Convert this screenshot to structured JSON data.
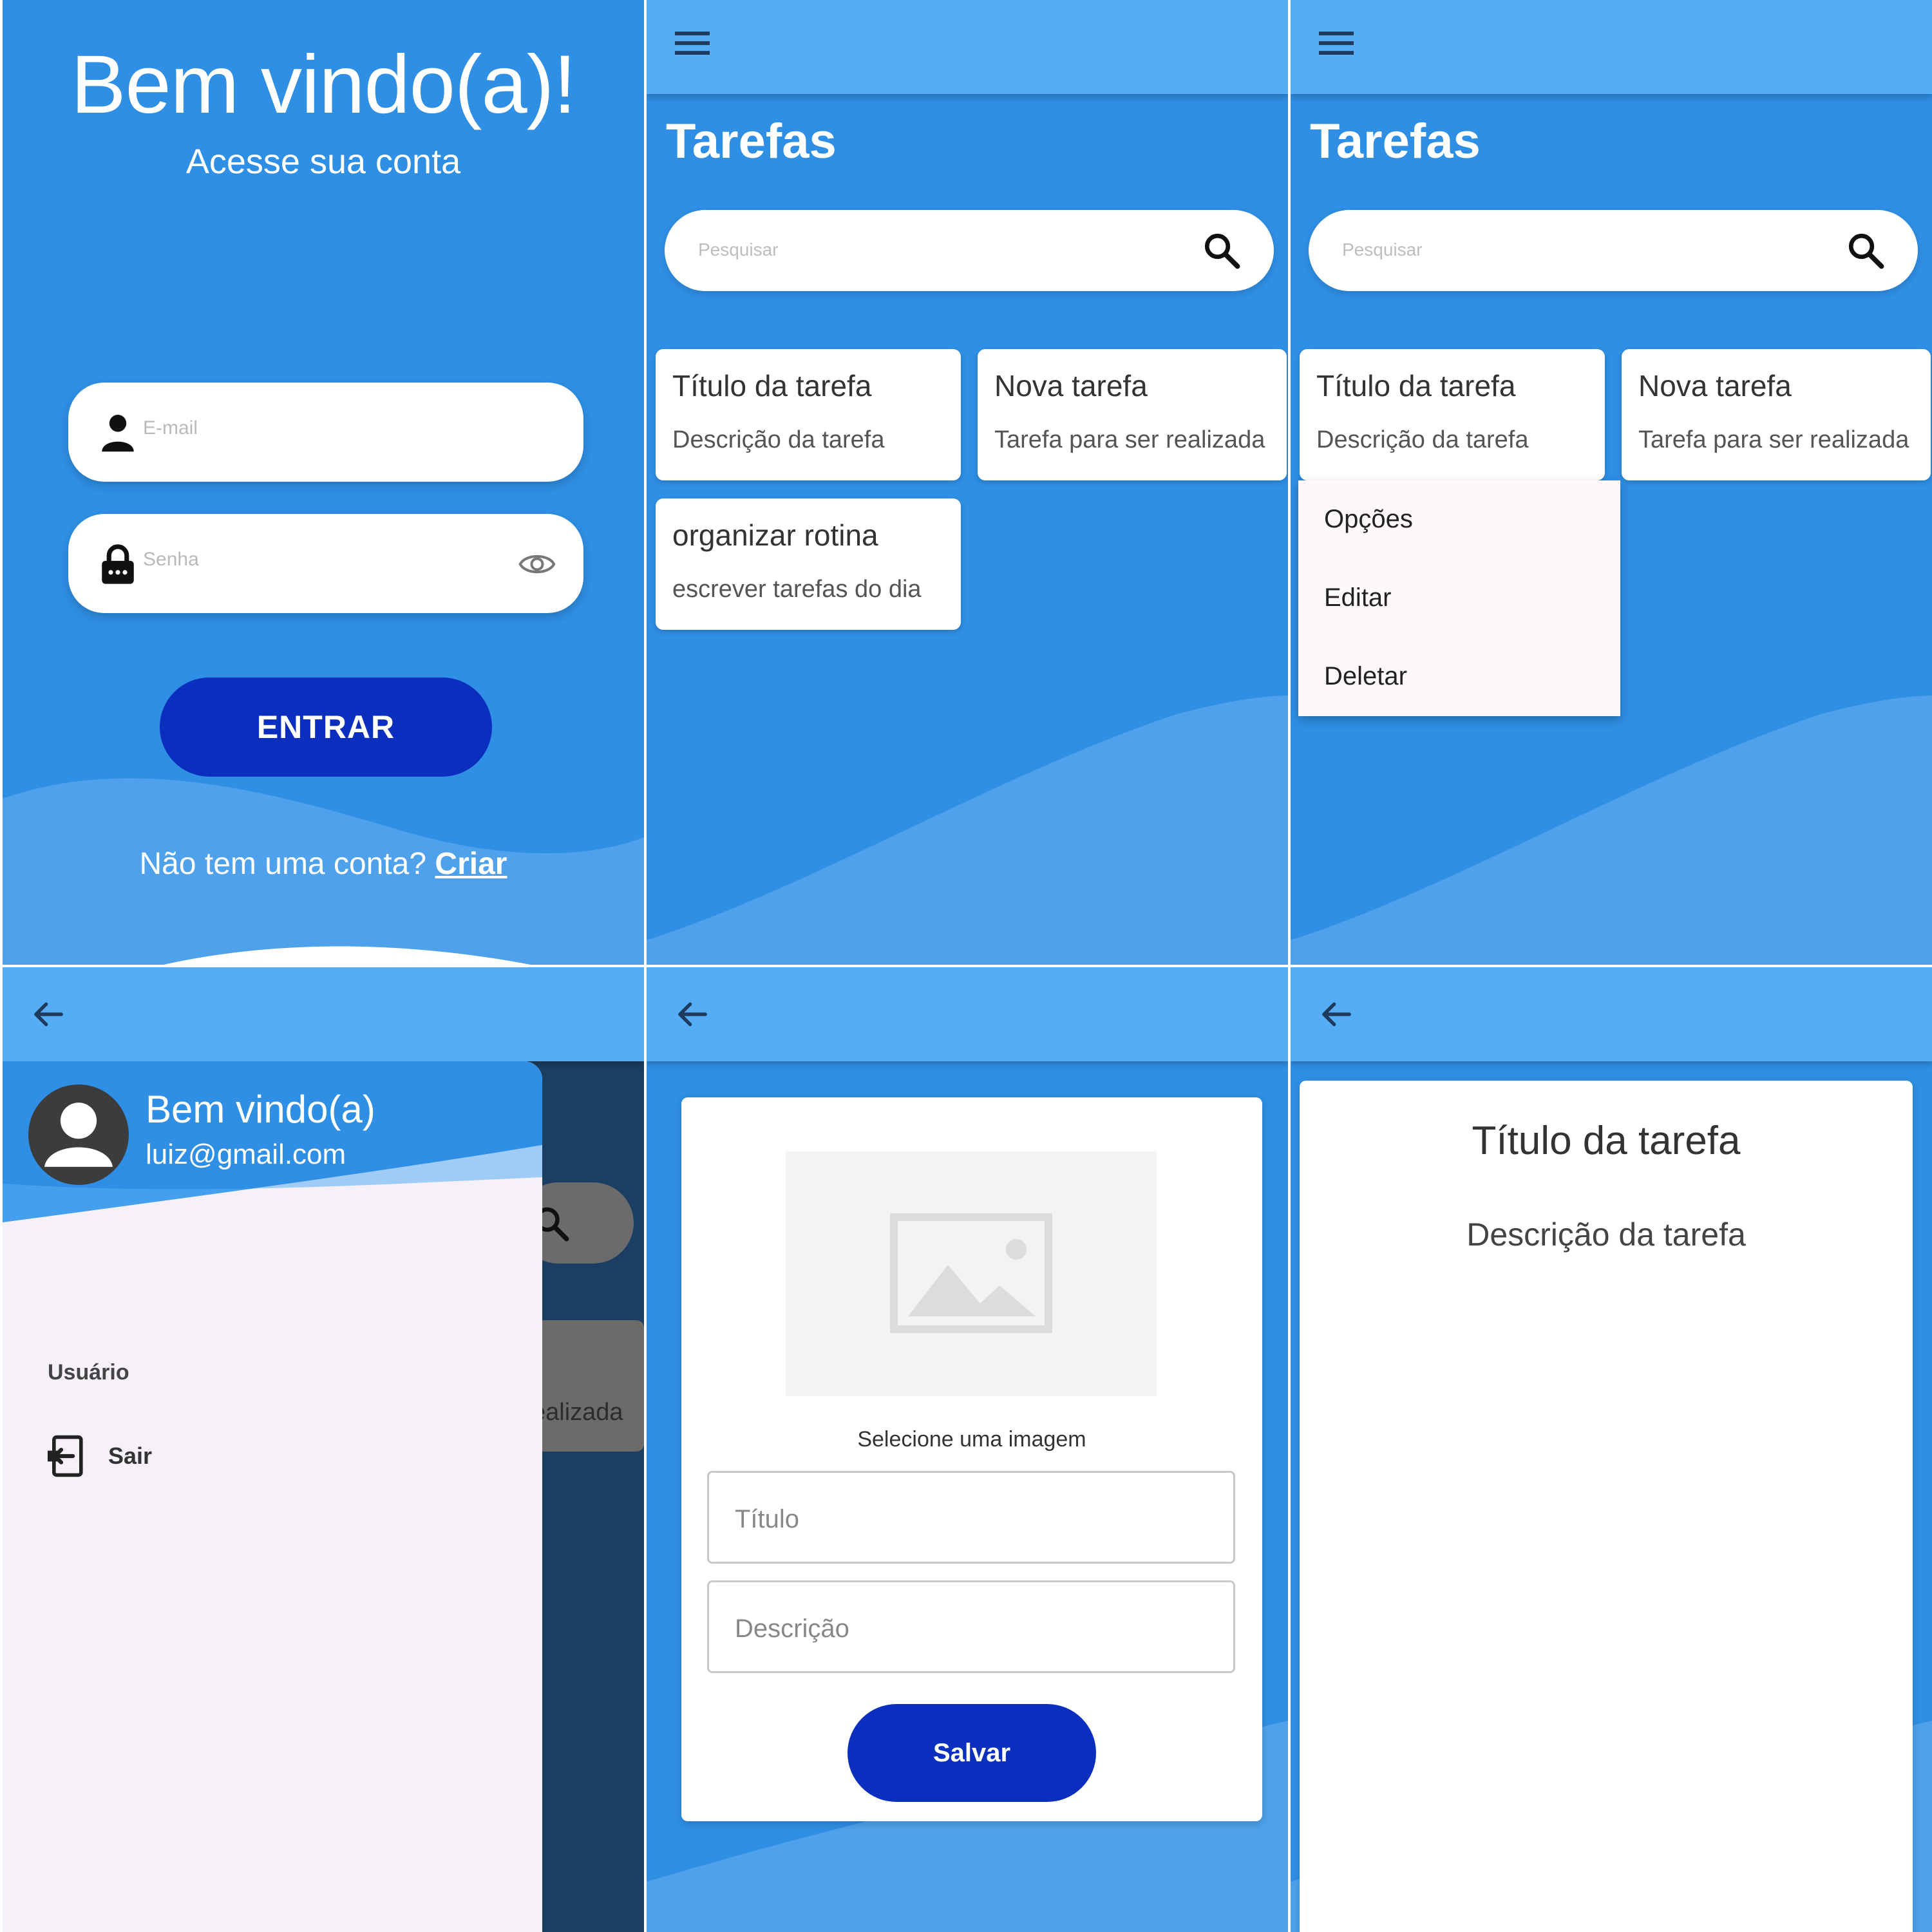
{
  "login": {
    "title": "Bem vindo(a)!",
    "subtitle": "Acesse sua conta",
    "email_placeholder": "E-mail",
    "password_placeholder": "Senha",
    "submit_label": "ENTRAR",
    "signup_prompt": "Não tem uma conta?",
    "signup_link": "Criar"
  },
  "tasks": {
    "title": "Tarefas",
    "search_placeholder": "Pesquisar",
    "items": [
      {
        "title": "Título da tarefa",
        "description": "Descrição da tarefa"
      },
      {
        "title": "Nova tarefa",
        "description": "Tarefa para ser realizada"
      },
      {
        "title": "organizar rotina",
        "description": "escrever tarefas do dia"
      }
    ]
  },
  "context_menu": {
    "items": [
      "Opções",
      "Editar",
      "Deletar"
    ]
  },
  "drawer": {
    "greeting": "Bem vindo(a)",
    "email": "luiz@gmail.com",
    "section_label": "Usuário",
    "logout_label": "Sair",
    "background_card_snippet": "ealizada"
  },
  "form": {
    "image_label": "Selecione uma imagem",
    "title_placeholder": "Título",
    "description_placeholder": "Descrição",
    "save_label": "Salvar"
  },
  "detail": {
    "title": "Título da tarefa",
    "description": "Descrição da tarefa"
  },
  "icons": {
    "menu": "menu-icon",
    "back": "back-arrow-icon",
    "search": "search-icon",
    "person": "person-icon",
    "lock": "lock-icon",
    "eye": "eye-icon",
    "image": "image-placeholder-icon",
    "logout": "logout-icon",
    "avatar": "avatar-icon"
  },
  "colors": {
    "background_blue": "#2f8fe4",
    "appbar_blue": "#55aef5",
    "wave_blue": "#4ea1ea",
    "button_blue": "#0a2fbf",
    "drawer_bg": "#f6f0f8",
    "scrim": "#1c3e63"
  }
}
